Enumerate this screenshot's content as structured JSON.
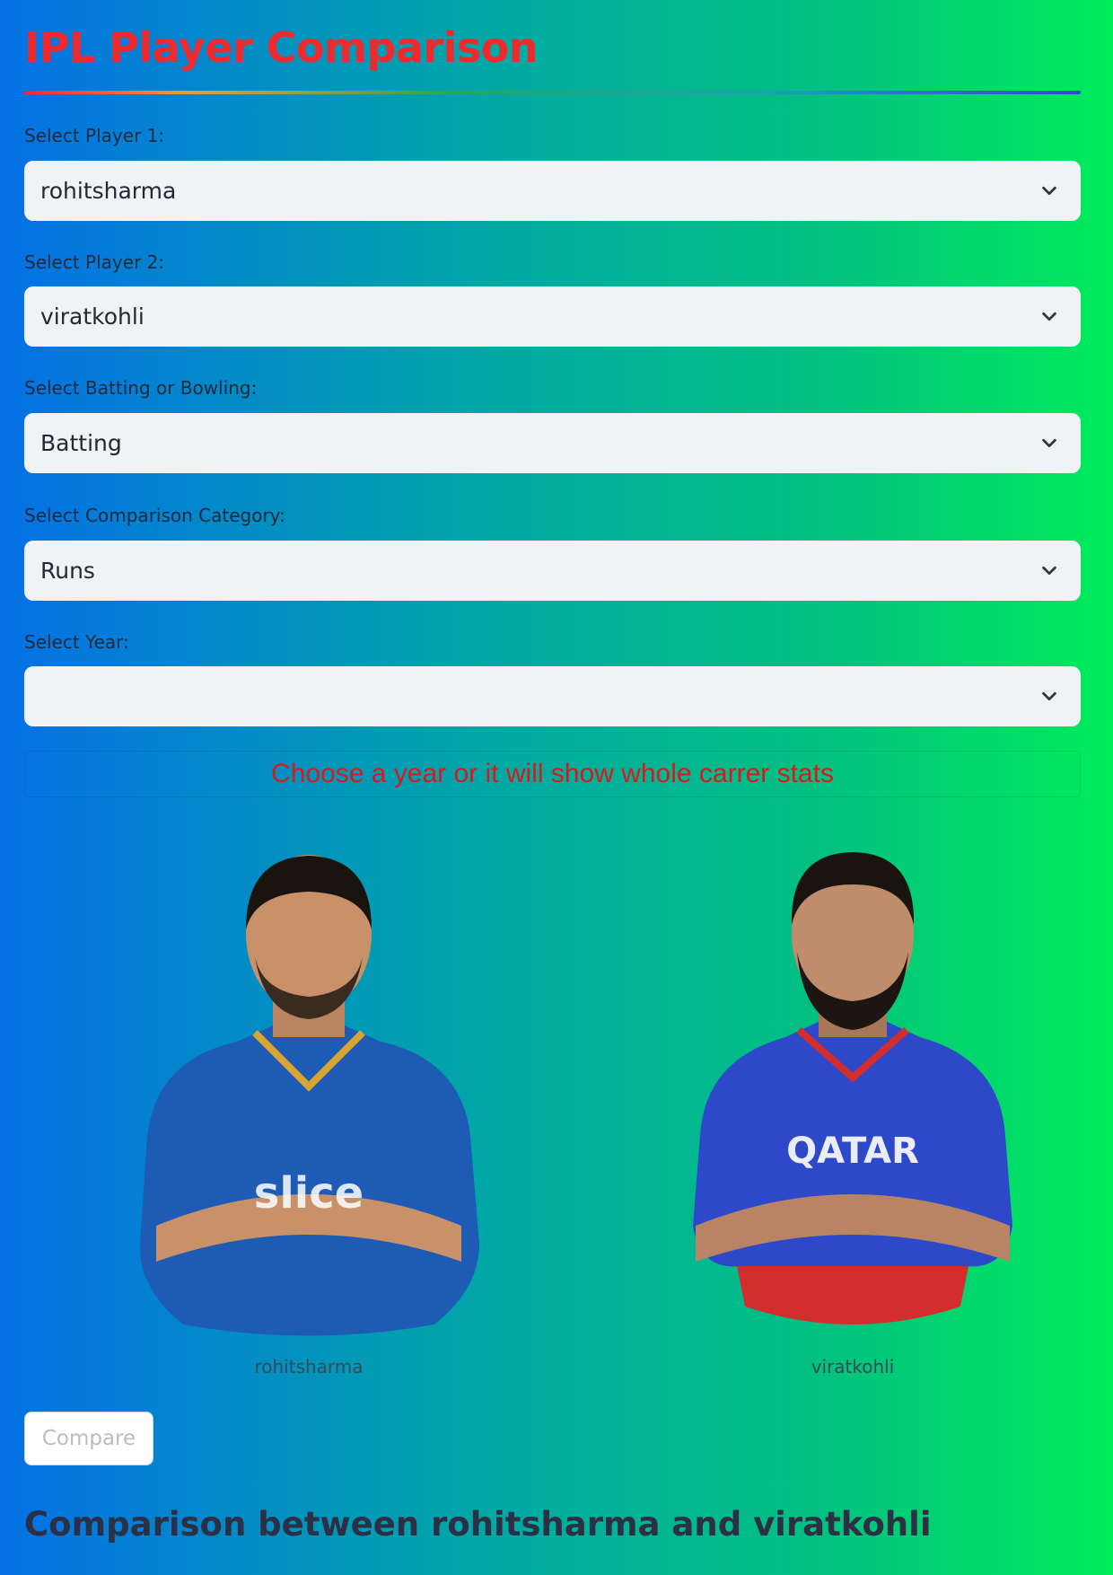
{
  "app": {
    "title": "IPL Player Comparison"
  },
  "form": {
    "player1": {
      "label": "Select Player 1:",
      "value": "rohitsharma"
    },
    "player2": {
      "label": "Select Player 2:",
      "value": "viratkohli"
    },
    "mode": {
      "label": "Select Batting or Bowling:",
      "value": "Batting"
    },
    "category": {
      "label": "Select Comparison Category:",
      "value": "Runs"
    },
    "year": {
      "label": "Select Year:",
      "value": ""
    }
  },
  "notice": "Choose a year or it will show whole carrer stats",
  "players": [
    {
      "caption": "rohitsharma",
      "jersey_color": "#1e5bb4",
      "accent": "#d8a531"
    },
    {
      "caption": "viratkohli",
      "jersey_color": "#2d49c9",
      "accent": "#d32d2d"
    }
  ],
  "actions": {
    "compare_label": "Compare"
  },
  "results": {
    "heading": "Comparison between rohitsharma and viratkohli"
  },
  "icons": {
    "dropdown": "chevron-down-icon"
  },
  "colors": {
    "title": "#ef2a2e",
    "notice": "#d61b1b"
  }
}
